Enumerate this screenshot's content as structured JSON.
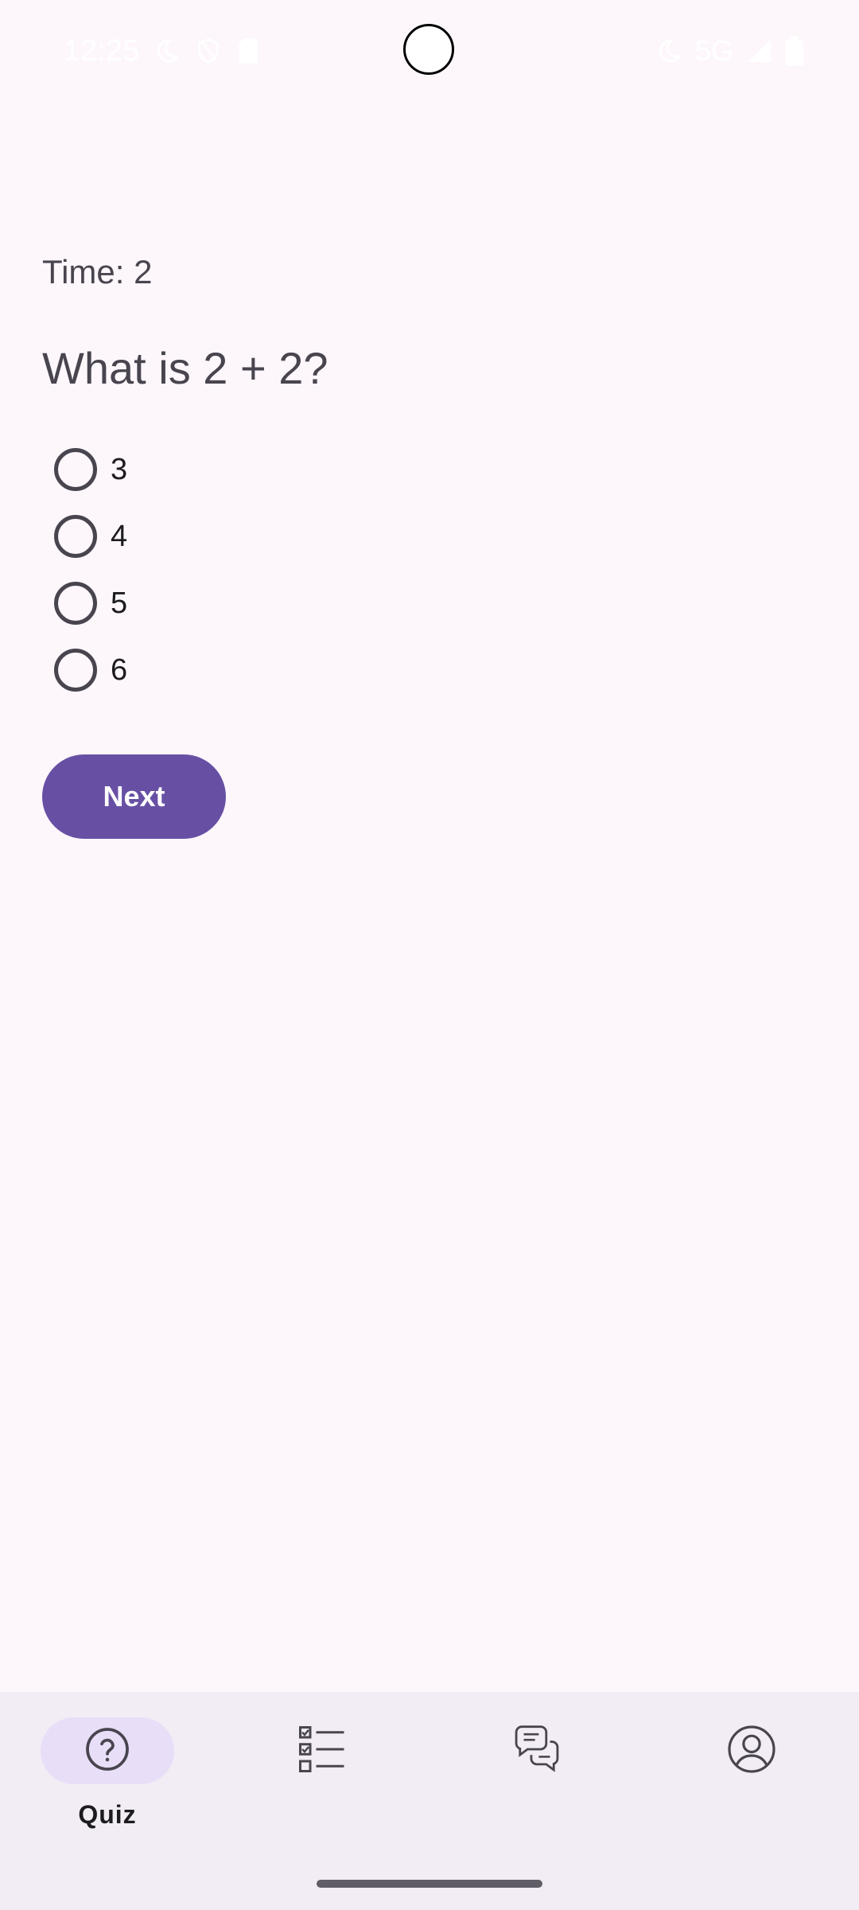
{
  "status_bar": {
    "time": "12:25",
    "network": "5G",
    "icons_left": [
      "moon-icon",
      "shield-icon",
      "sim-card-icon"
    ],
    "icons_right": [
      "moon-icon",
      "signal-icon",
      "battery-icon"
    ]
  },
  "quiz": {
    "timer": "Time: 2",
    "question": "What is 2 + 2?",
    "options": [
      {
        "label": "3",
        "selected": false
      },
      {
        "label": "4",
        "selected": false
      },
      {
        "label": "5",
        "selected": false
      },
      {
        "label": "6",
        "selected": false
      }
    ],
    "next_label": "Next"
  },
  "bottom_nav": {
    "items": [
      {
        "label": "Quiz",
        "icon": "help-circle-icon",
        "active": true
      },
      {
        "label": "",
        "icon": "checklist-icon",
        "active": false
      },
      {
        "label": "",
        "icon": "chat-bubbles-icon",
        "active": false
      },
      {
        "label": "",
        "icon": "account-icon",
        "active": false
      }
    ]
  },
  "colors": {
    "background": "#FDF7FC",
    "primary": "#6750A4",
    "nav_background": "#F2ECF5",
    "nav_active_pill": "#E8DEF8",
    "text_secondary": "#49454F"
  }
}
